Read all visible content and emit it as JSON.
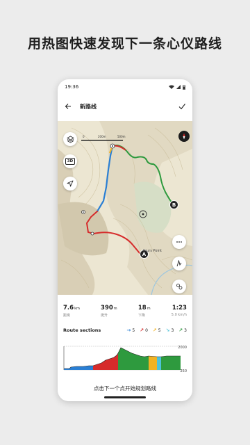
{
  "promo": {
    "title": "用热图快速发现下一条心仪路线"
  },
  "status": {
    "time": "19:36"
  },
  "appbar": {
    "title": "新路线"
  },
  "map": {
    "scale_labels": [
      "0",
      "200m",
      "500m"
    ],
    "place_label": "thurs Point",
    "marker_a": "A",
    "marker_b": "B",
    "compass_letter": "N",
    "layers_icon": "layers-icon",
    "threed_label": "3D",
    "nav_icon": "navigation-arrow-icon",
    "more_icon": "more-icon",
    "draw_icon": "draw-route-icon",
    "settings_icon": "route-settings-icon"
  },
  "stats": [
    {
      "value": "7.6",
      "unit": "km",
      "label": "距离"
    },
    {
      "value": "390",
      "unit": "m",
      "label": "爬升"
    },
    {
      "value": "18",
      "unit": "m",
      "label": "下降"
    },
    {
      "value": "1:23",
      "unit": "",
      "label": "5.0 km/h"
    }
  ],
  "sections": {
    "label": "Route sections",
    "items": [
      {
        "count": "5",
        "color": "#2a7fd4",
        "icon": "flat-arrow-icon",
        "arrow": "→"
      },
      {
        "count": "0",
        "color": "#d62b2b",
        "icon": "steep-up-arrow-icon",
        "arrow": "↗"
      },
      {
        "count": "5",
        "color": "#f2b322",
        "icon": "up-arrow-icon",
        "arrow": "↗"
      },
      {
        "count": "3",
        "color": "#4fc3d9",
        "icon": "down-arrow-icon",
        "arrow": "↘"
      },
      {
        "count": "3",
        "color": "#2e9a3e",
        "icon": "gentle-arrow-icon",
        "arrow": "↗"
      }
    ]
  },
  "profile": {
    "max_label": "2000",
    "min_label": "250"
  },
  "hint": "点击下一个点开始规划路线",
  "colors": {
    "red": "#d62b2b",
    "green": "#2e9a3e",
    "blue": "#2a7fd4",
    "yellow": "#f2b322",
    "cyan": "#4fc3d9"
  }
}
